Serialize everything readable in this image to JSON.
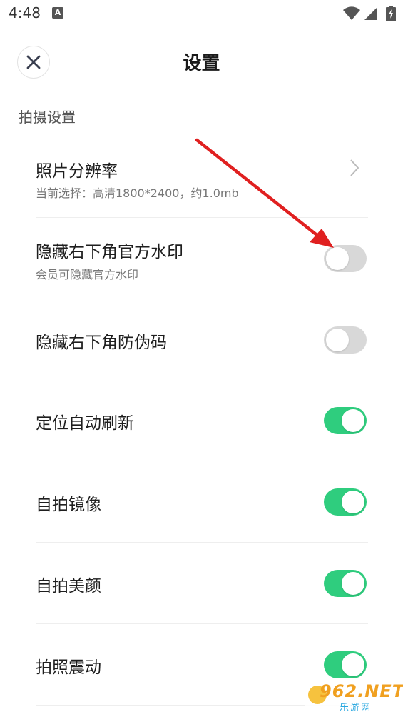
{
  "status_bar": {
    "time": "4:48",
    "notification_icon": "A"
  },
  "header": {
    "title": "设置",
    "close_icon": "close-icon"
  },
  "section": {
    "title": "拍摄设置"
  },
  "settings": [
    {
      "label": "照片分辨率",
      "subtitle": "当前选择：高清1800*2400，约1.0mb",
      "control": "chevron"
    },
    {
      "label": "隐藏右下角官方水印",
      "subtitle": "会员可隐藏官方水印",
      "control": "toggle",
      "on": false
    },
    {
      "label": "隐藏右下角防伪码",
      "control": "toggle",
      "on": false
    },
    {
      "label": "定位自动刷新",
      "control": "toggle",
      "on": true
    },
    {
      "label": "自拍镜像",
      "control": "toggle",
      "on": true
    },
    {
      "label": "自拍美颜",
      "control": "toggle",
      "on": true
    },
    {
      "label": "拍照震动",
      "control": "toggle",
      "on": true
    }
  ],
  "watermark": {
    "top": "962.NET",
    "bottom": "乐游网"
  },
  "colors": {
    "toggle_on": "#2fcd7e",
    "toggle_off": "#d8d8d8",
    "annotation_arrow": "#e02020"
  }
}
